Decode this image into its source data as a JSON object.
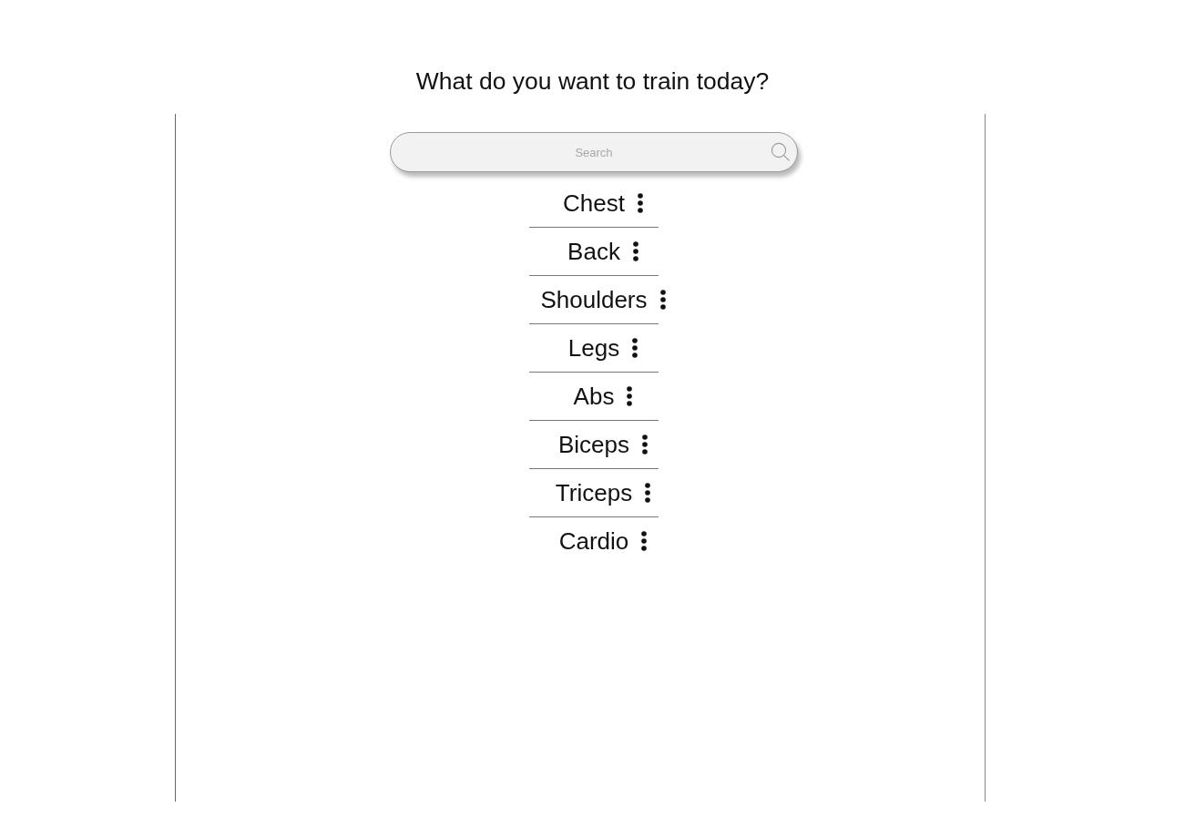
{
  "heading": "What do you want to train today?",
  "search": {
    "placeholder": "Search"
  },
  "muscle_groups": [
    {
      "label": "Chest"
    },
    {
      "label": "Back"
    },
    {
      "label": "Shoulders"
    },
    {
      "label": "Legs"
    },
    {
      "label": "Abs"
    },
    {
      "label": "Biceps"
    },
    {
      "label": "Triceps"
    },
    {
      "label": "Cardio"
    }
  ]
}
